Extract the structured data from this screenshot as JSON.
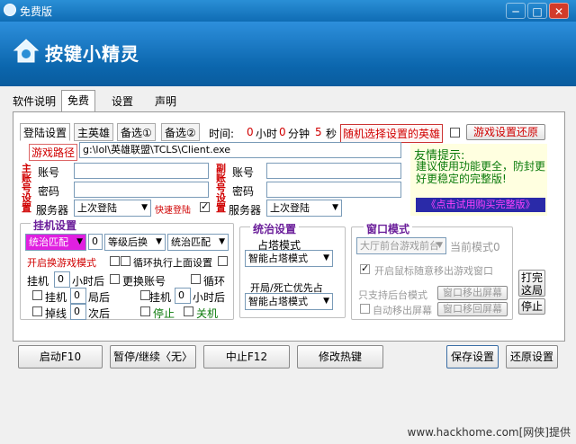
{
  "window": {
    "title": "免费版",
    "minimize": "─",
    "maximize": "□",
    "close": "✕"
  },
  "header": {
    "logo_text": "按键小精灵"
  },
  "top_tabs": [
    "软件说明",
    "免费",
    "设置",
    "声明"
  ],
  "sub_tabs": [
    "登陆设置",
    "主英雄",
    "备选①",
    "备选②"
  ],
  "timer": {
    "label_time": "时间:",
    "hours_val": "0",
    "hours_label": "小时",
    "min_val": "0",
    "min_label": "分钟",
    "sec_val": "5",
    "sec_label": "秒"
  },
  "random_hero": {
    "label": "随机选择设置的英雄"
  },
  "restore_game": {
    "label": "游戏设置还原"
  },
  "game_path": {
    "label": "游戏路径",
    "value": "g:\\lol\\英雄联盟\\TCLS\\Client.exe"
  },
  "main_account": {
    "side_label": "主账号设置",
    "account_label": "账号",
    "password_label": "密码",
    "server_label": "服务器",
    "server_value": "上次登陆",
    "quick_login": "快速登陆"
  },
  "sub_account": {
    "side_label": "副账号设置",
    "account_label": "账号",
    "password_label": "密码",
    "server_label": "服务器",
    "server_value": "上次登陆"
  },
  "tip": {
    "title": "友情提示:",
    "body": "建议使用功能更全，防封更好更稳定的完整版!",
    "buy_link": "《点击试用购买完整版》"
  },
  "hangup": {
    "title": "挂机设置",
    "mode_value": "统治匹配",
    "level_value": "0",
    "rank_value": "等级后换",
    "mode2_value": "统治匹配",
    "open_game_label": "开启换游戏模式",
    "loop_exec_label": "循环执行上面设置",
    "hangup_label": "挂机",
    "hangup_val": "0",
    "hours_after": "小时后",
    "change_account": "更换账号",
    "loop": "循环",
    "hangup2": "挂机",
    "hangup2_val": "0",
    "rounds_after": "局后",
    "hangup3": "挂机",
    "hangup3_val": "0",
    "hours_after2": "小时后",
    "disconnect": "掉线",
    "disconnect_val": "0",
    "times_after": "次后",
    "stop": "停止",
    "shutdown": "关机"
  },
  "domination": {
    "title": "统治设置",
    "tower_label": "占塔模式",
    "tower_value": "智能占塔模式",
    "start_label": "开局/死亡优先占",
    "start_value": "智能占塔模式"
  },
  "window_mode": {
    "title": "窗口模式",
    "mode_value": "大厅前台游戏前台",
    "current": "当前模式0",
    "mouse_label": "开启鼠标随意移出游戏窗口",
    "note_top": "只支持后台模式",
    "note_bottom": "自动移出屏幕",
    "move_out": "窗口移出屏幕",
    "move_back": "窗口移回屏幕",
    "open_check": "打完这局",
    "stop_btn": "停止"
  },
  "bottom_buttons": {
    "start": "启动F10",
    "pause": "暂停/继续〈无〉",
    "stop": "中止F12",
    "hotkey": "修改热键",
    "save": "保存设置",
    "restore": "还原设置"
  },
  "watermark": "www.hackhome.com[网侠]提供"
}
